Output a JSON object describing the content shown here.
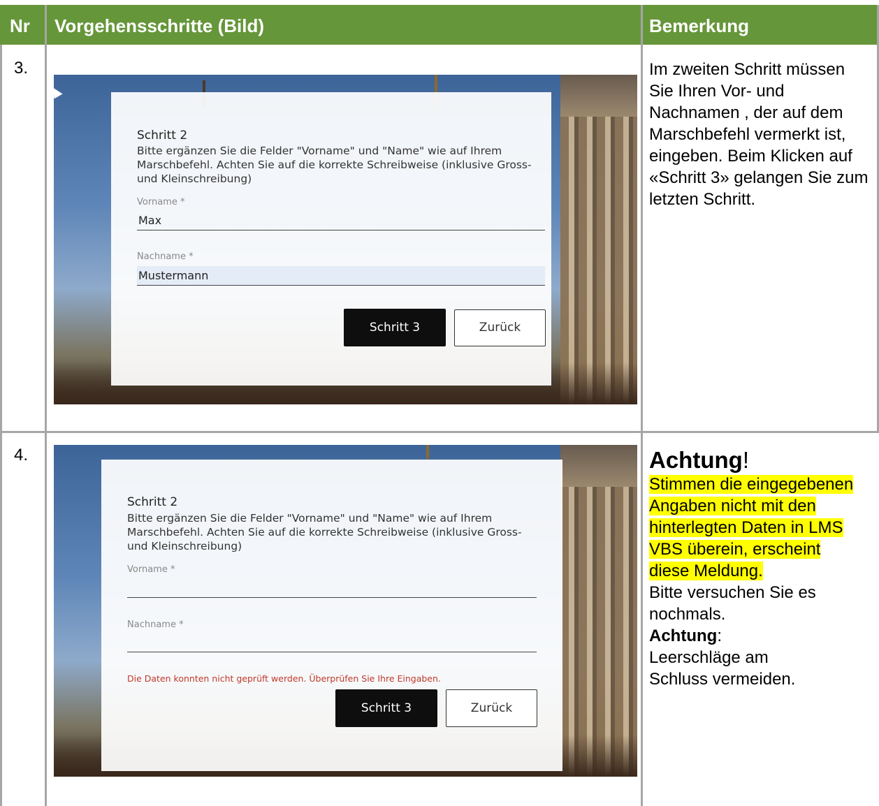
{
  "header": {
    "nr": "Nr",
    "steps": "Vorgehensschritte (Bild)",
    "remark": "Bemerkung"
  },
  "rows": [
    {
      "nr": "3.",
      "screenshot": {
        "title": "Schritt 2",
        "instruction": "Bitte ergänzen Sie die Felder \"Vorname\" und \"Name\" wie auf Ihrem Marschbefehl. Achten Sie auf die korrekte Schreibweise (inklusive Gross- und Kleinschreibung)",
        "firstname_label": "Vorname *",
        "firstname_value": "Max",
        "lastname_label": "Nachname *",
        "lastname_value": "Mustermann",
        "next_button": "Schritt 3",
        "back_button": "Zurück"
      },
      "remark": "Im zweiten Schritt müssen Sie Ihren Vor- und Nachnamen , der auf dem Marschbefehl vermerkt ist, eingeben. Beim Klicken auf «Schritt 3» gelangen Sie zum letzten Schritt."
    },
    {
      "nr": "4.",
      "screenshot": {
        "title": "Schritt 2",
        "instruction": "Bitte ergänzen Sie die Felder \"Vorname\" und \"Name\" wie auf Ihrem Marschbefehl. Achten Sie auf die korrekte Schreibweise (inklusive Gross- und Kleinschreibung)",
        "firstname_label": "Vorname *",
        "firstname_value": "",
        "lastname_label": "Nachname *",
        "lastname_value": "",
        "error": "Die Daten konnten nicht geprüft werden. Überprüfen Sie Ihre Eingaben.",
        "next_button": "Schritt 3",
        "back_button": "Zurück"
      },
      "remark": {
        "heading": "Achtung",
        "heading_suffix": "!",
        "highlighted": "Stimmen die eingegebenen Angaben nicht mit den hinterlegten Daten in LMS VBS überein, erscheint diese Meldung.",
        "retry": "Bitte versuchen Sie es nochmals.",
        "note_label": "Achtung",
        "note_suffix": ":",
        "note": "Leerschläge am Schluss vermeiden."
      }
    }
  ],
  "colors": {
    "header_bg": "#66963a",
    "grid": "#a6a6a6",
    "highlight": "#ffff00",
    "error_text": "#c0392b"
  }
}
